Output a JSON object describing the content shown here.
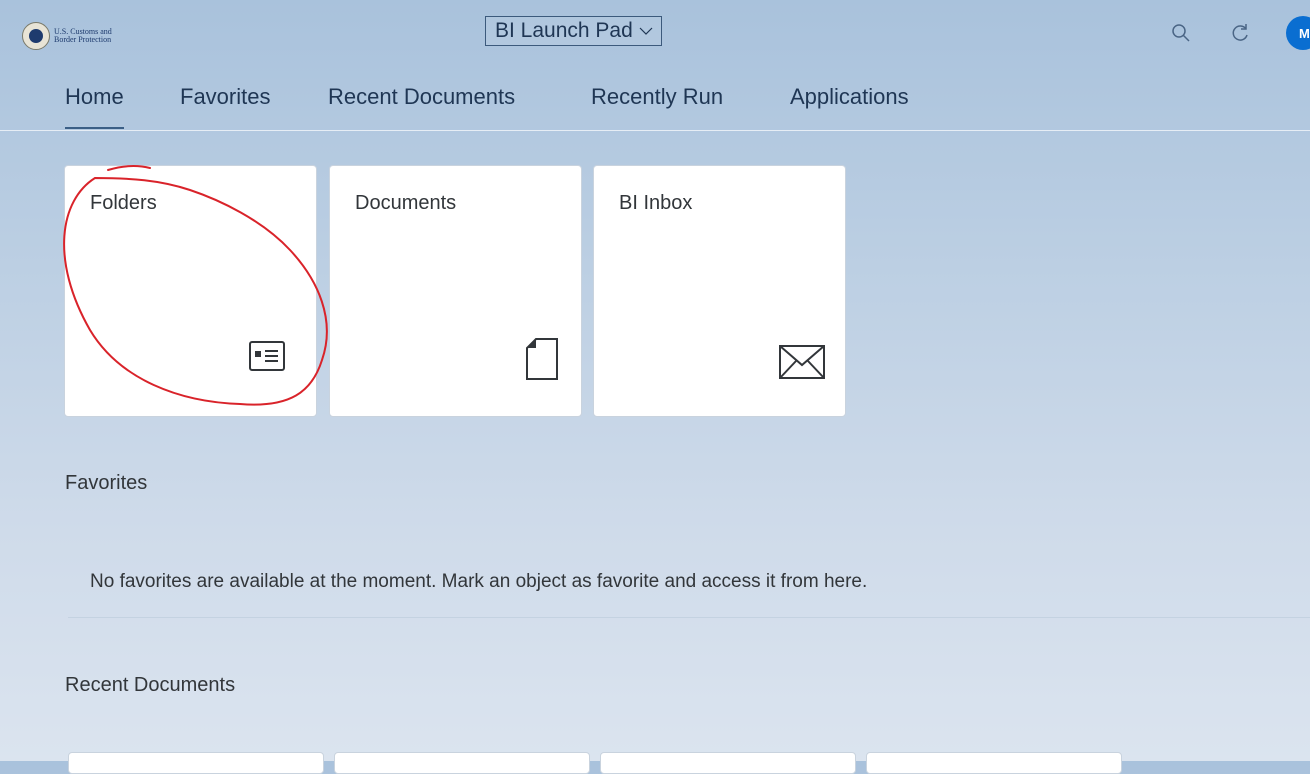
{
  "header": {
    "logo_line1": "U.S. Customs and",
    "logo_line2": "Border Protection",
    "app_title": "BI Launch Pad",
    "avatar_initial": "M",
    "icons": [
      "search-icon",
      "refresh-icon",
      "chevron-down-icon"
    ]
  },
  "tabs": [
    {
      "label": "Home",
      "active": true
    },
    {
      "label": "Favorites",
      "active": false
    },
    {
      "label": "Recent Documents",
      "active": false
    },
    {
      "label": "Recently Run",
      "active": false
    },
    {
      "label": "Applications",
      "active": false
    }
  ],
  "tiles": [
    {
      "title": "Folders",
      "icon": "folder-card-icon"
    },
    {
      "title": "Documents",
      "icon": "document-icon"
    },
    {
      "title": "BI Inbox",
      "icon": "envelope-icon"
    }
  ],
  "favorites": {
    "title": "Favorites",
    "empty_message": "No favorites are available at the moment. Mark an object as favorite and access it from here."
  },
  "recent_documents": {
    "title": "Recent Documents"
  },
  "colors": {
    "accent": "#0a6ed1",
    "annotation": "#d9232a",
    "text": "#32363a",
    "nav_text": "#1f3654"
  }
}
